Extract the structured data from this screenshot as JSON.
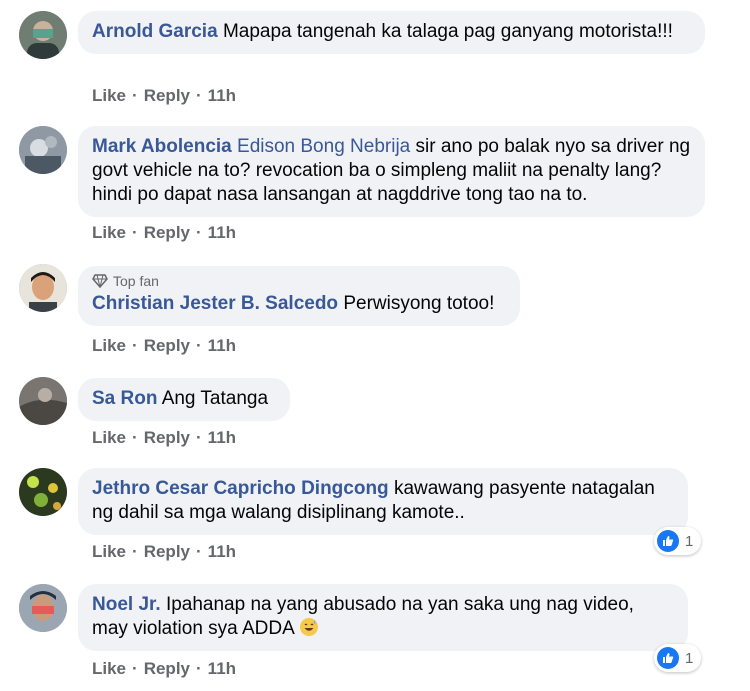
{
  "comments": [
    {
      "name": "Arnold Garcia",
      "text": "Mapapa tangenah ka talaga pag ganyang motorista!!!",
      "like": "Like",
      "reply": "Reply",
      "time": "11h"
    },
    {
      "name": "Mark Abolencia",
      "tag": "Edison Bong Nebrija",
      "text": "sir ano po balak nyo sa driver ng govt vehicle na to? revocation ba o simpleng maliit na penalty lang? hindi po dapat nasa lansangan at nagddrive tong tao na to.",
      "like": "Like",
      "reply": "Reply",
      "time": "11h"
    },
    {
      "badge": "Top fan",
      "name": "Christian Jester B. Salcedo",
      "text": "Perwisyong totoo!",
      "like": "Like",
      "reply": "Reply",
      "time": "11h"
    },
    {
      "name": "Sa Ron",
      "text": "Ang Tatanga",
      "like": "Like",
      "reply": "Reply",
      "time": "11h"
    },
    {
      "name": "Jethro Cesar Capricho Dingcong",
      "text": "kawawang pasyente natagalan ng dahil sa mga walang disiplinang kamote..",
      "like": "Like",
      "reply": "Reply",
      "time": "11h",
      "reaction_count": "1"
    },
    {
      "name": "Noel Jr.",
      "text": "Ipahanap na yang abusado na yan saka ung nag video, may violation sya ADDA",
      "like": "Like",
      "reply": "Reply",
      "time": "11h",
      "reaction_count": "1",
      "emoji": "sweat-smile-emoji"
    }
  ],
  "colors": {
    "name": "#385898",
    "bubble": "#f0f2f5",
    "meta": "#65676b",
    "like": "#1877f2"
  }
}
